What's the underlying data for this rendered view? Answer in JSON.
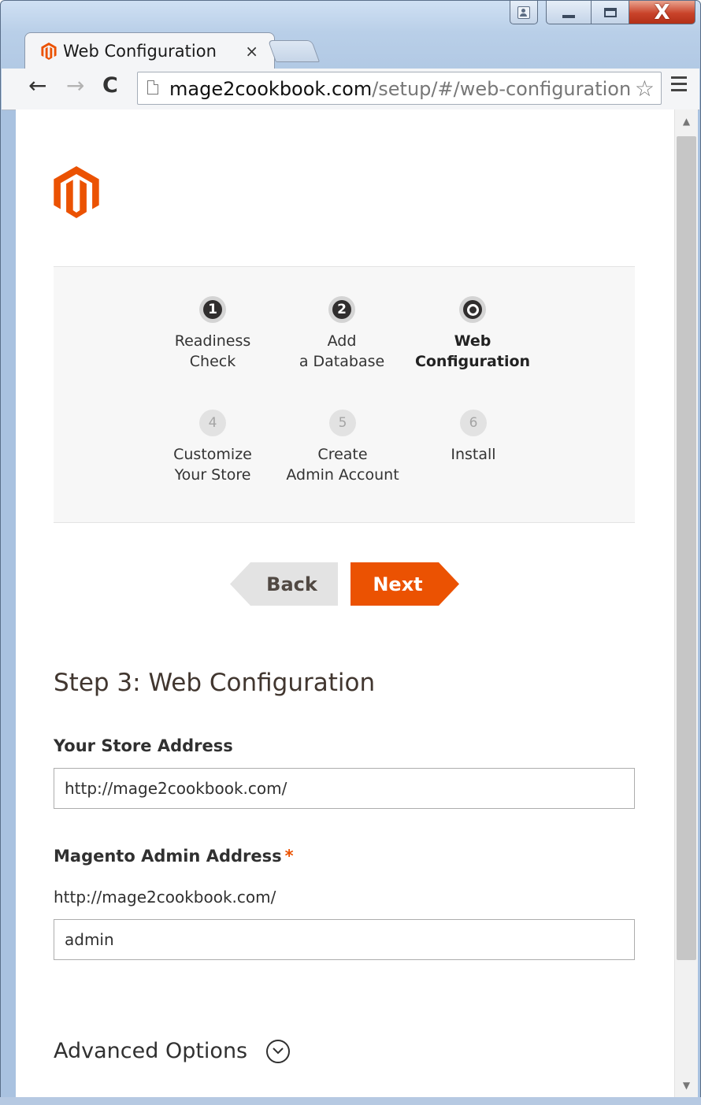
{
  "browser": {
    "tab_title": "Web Configuration",
    "tab_close": "×",
    "url_host": "mage2cookbook.com",
    "url_path": "/setup/#/web-configuration",
    "back_glyph": "←",
    "forward_glyph": "→",
    "reload_glyph": "C",
    "star_glyph": "☆",
    "close_glyph": "X",
    "icons": [
      "user-icon",
      "minimize-icon",
      "maximize-icon",
      "close-icon",
      "back-arrow-icon",
      "forward-arrow-icon",
      "reload-icon",
      "page-icon",
      "star-icon",
      "menu-icon"
    ]
  },
  "brand": {
    "logo": "magento-logo-icon",
    "accent_color": "#eb5202"
  },
  "wizard": {
    "steps": [
      {
        "number": "1",
        "label_line1": "Readiness",
        "label_line2": "Check",
        "state": "done"
      },
      {
        "number": "2",
        "label_line1": "Add",
        "label_line2": "a Database",
        "state": "done"
      },
      {
        "number": "3",
        "label_line1": "Web",
        "label_line2": "Configuration",
        "state": "current"
      },
      {
        "number": "4",
        "label_line1": "Customize",
        "label_line2": "Your Store",
        "state": "todo"
      },
      {
        "number": "5",
        "label_line1": "Create",
        "label_line2": "Admin Account",
        "state": "todo"
      },
      {
        "number": "6",
        "label_line1": "Install",
        "label_line2": "",
        "state": "todo"
      }
    ],
    "back_label": "Back",
    "next_label": "Next"
  },
  "form": {
    "heading": "Step 3: Web Configuration",
    "store_address_label": "Your Store Address",
    "store_address_value": "http://mage2cookbook.com/",
    "admin_address_label": "Magento Admin Address",
    "admin_required_mark": "*",
    "admin_prefix": "http://mage2cookbook.com/",
    "admin_address_value": "admin",
    "advanced_label": "Advanced Options"
  }
}
